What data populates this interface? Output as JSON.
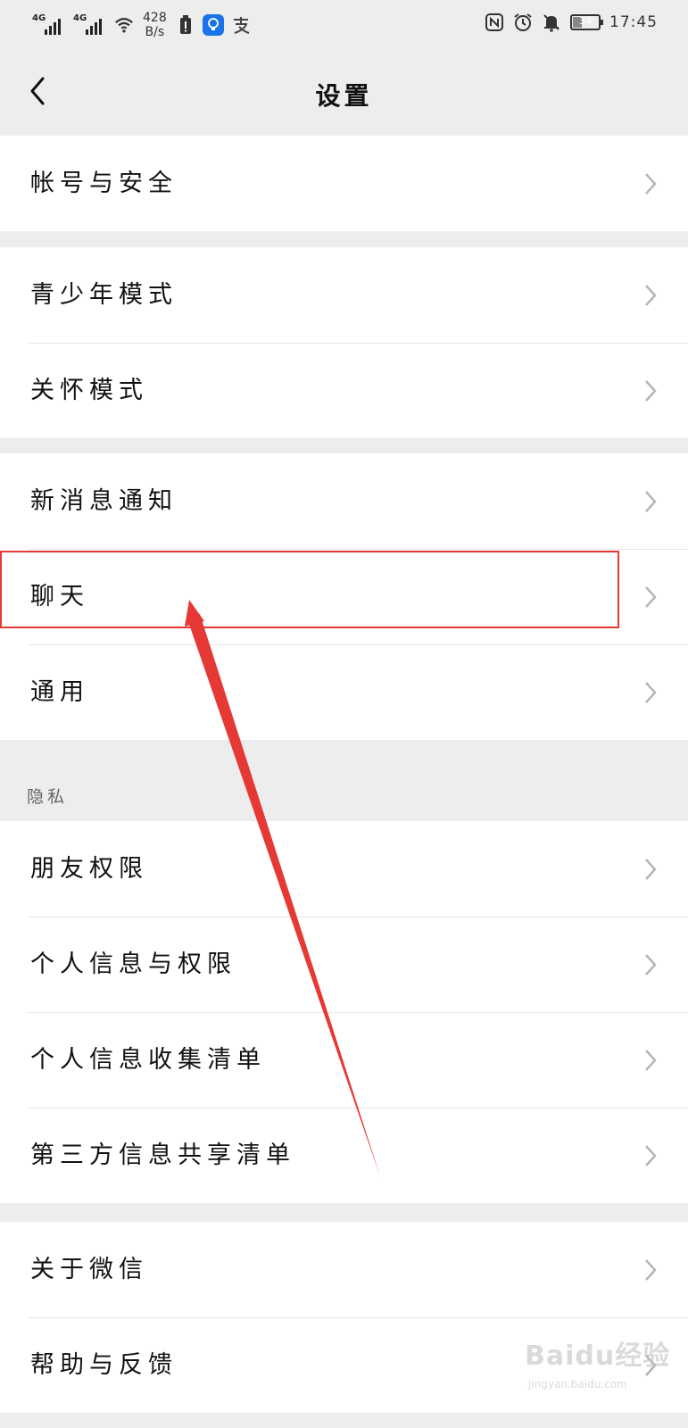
{
  "status_bar": {
    "signal1_label": "4G",
    "signal2_label": "4G",
    "net_speed_value": "428",
    "net_speed_unit": "B/s",
    "battery_level": "34",
    "time": "17:45",
    "icons": [
      "signal-icon",
      "signal-icon",
      "wifi-icon",
      "battery-saver-icon",
      "lightbulb-app-icon",
      "alipay-icon",
      "nfc-icon",
      "alarm-icon",
      "mute-bell-icon",
      "battery-icon"
    ]
  },
  "nav": {
    "title": "设置",
    "back_icon": "chevron-left-icon"
  },
  "groups": [
    {
      "items": [
        {
          "label": "帐号与安全"
        }
      ]
    },
    {
      "items": [
        {
          "label": "青少年模式"
        },
        {
          "label": "关怀模式"
        }
      ]
    },
    {
      "items": [
        {
          "label": "新消息通知"
        },
        {
          "label": "聊天"
        },
        {
          "label": "通用"
        }
      ]
    },
    {
      "header": "隐私",
      "items": [
        {
          "label": "朋友权限"
        },
        {
          "label": "个人信息与权限"
        },
        {
          "label": "个人信息收集清单"
        },
        {
          "label": "第三方信息共享清单"
        }
      ]
    },
    {
      "items": [
        {
          "label": "关于微信"
        },
        {
          "label": "帮助与反馈"
        }
      ]
    }
  ],
  "annotation": {
    "highlight_color": "#e53935",
    "highlighted_item": "聊天"
  },
  "watermark": {
    "logo": "Baidu经验",
    "site": "jingyan.baidu.com"
  },
  "colors": {
    "page_bg": "#ededed",
    "row_bg": "#ffffff",
    "chevron": "#b5b5b5"
  }
}
